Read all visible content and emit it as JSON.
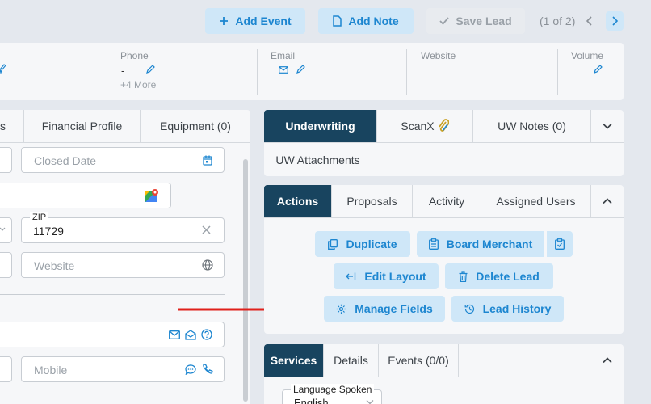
{
  "toolbar": {
    "add_event": "Add Event",
    "add_note": "Add Note",
    "save_lead": "Save Lead",
    "pager": "(1 of 2)"
  },
  "info": {
    "phone_label": "Phone",
    "phone_value": "-",
    "phone_more": "+4 More",
    "email_label": "Email",
    "website_label": "Website",
    "volume_label": "Volume"
  },
  "left_tabs": {
    "financial_profile": "Financial Profile",
    "equipment": "Equipment (0)"
  },
  "left_form": {
    "closed_date_placeholder": "Closed Date",
    "zip_label": "ZIP",
    "zip_value": "11729",
    "website_placeholder": "Website",
    "mobile_placeholder": "Mobile"
  },
  "uw_tabs": {
    "underwriting": "Underwriting",
    "scanx": "ScanX",
    "uw_notes": "UW Notes (0)",
    "uw_attachments": "UW Attachments"
  },
  "action_tabs": {
    "actions": "Actions",
    "proposals": "Proposals",
    "activity": "Activity",
    "assigned_users": "Assigned Users"
  },
  "actions": {
    "duplicate": "Duplicate",
    "board_merchant": "Board Merchant",
    "edit_layout": "Edit Layout",
    "delete_lead": "Delete Lead",
    "manage_fields": "Manage Fields",
    "lead_history": "Lead History"
  },
  "service_tabs": {
    "services": "Services",
    "details": "Details",
    "events": "Events (0/0)"
  },
  "services": {
    "language_label": "Language Spoken",
    "language_value": "English"
  },
  "colors": {
    "accent_blue": "#1d86d0",
    "button_bg": "#cfe7f8",
    "active_tab": "#18445f",
    "annotation_arrow": "#e0201b"
  },
  "icons": {
    "add_event": "plus-icon",
    "add_note": "note-icon",
    "save_lead": "check-icon",
    "duplicate": "copy-icon",
    "board_merchant": "clipboard-icon",
    "edit_layout": "arrow-left-bar-icon",
    "delete_lead": "trash-icon",
    "manage_fields": "gear-icon",
    "lead_history": "history-icon"
  }
}
